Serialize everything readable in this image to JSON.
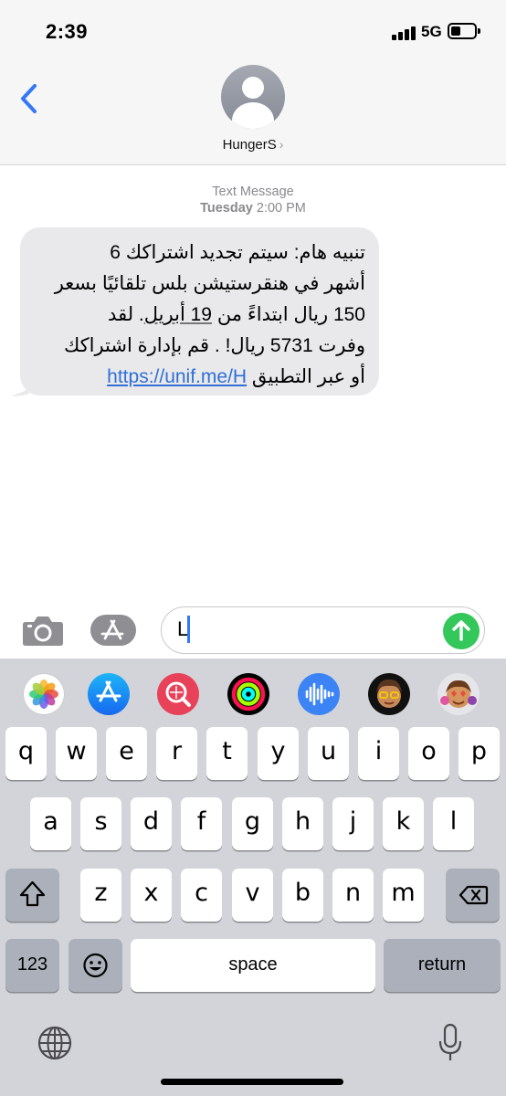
{
  "status_bar": {
    "time": "2:39",
    "network": "5G",
    "battery_icon": "battery-icon",
    "signal_icon": "cellular-signal-icon"
  },
  "header": {
    "back_icon": "chevron-left-icon",
    "avatar_icon": "person-avatar-icon",
    "contact_name": "HungerS",
    "name_chevron": "›"
  },
  "conversation": {
    "message_type": "Text Message",
    "timestamp_day": "Tuesday",
    "timestamp_time": "2:00 PM",
    "message": {
      "line1": "تنبيه هام: سيتم تجديد اشتراكك 6",
      "line2": "أشهر في هنقرستيشن بلس تلقائيًا بسعر",
      "line3_a": "150 ريال ابتداءً من ",
      "line3_date": "19 أبريل",
      "line3_b": ". لقد",
      "line4": "وفرت 5731 ريال! . قم بإدارة اشتراكك",
      "line5_a": "أو عبر التطبيق ",
      "line5_link": "https://unif.me/H"
    }
  },
  "input_bar": {
    "camera_icon": "camera-icon",
    "apps_icon": "app-store-icon",
    "text_value": "L",
    "send_icon": "arrow-up-icon"
  },
  "app_strip": [
    "photos-icon",
    "app-store-icon",
    "image-search-icon",
    "activity-rings-icon",
    "audio-message-icon",
    "memoji-icon",
    "memoji-stickers-icon"
  ],
  "keyboard": {
    "row1": [
      "q",
      "w",
      "e",
      "r",
      "t",
      "y",
      "u",
      "i",
      "o",
      "p"
    ],
    "row2": [
      "a",
      "s",
      "d",
      "f",
      "g",
      "h",
      "j",
      "k",
      "l"
    ],
    "row3": [
      "z",
      "x",
      "c",
      "v",
      "b",
      "n",
      "m"
    ],
    "numbers_label": "123",
    "space_label": "space",
    "return_label": "return",
    "shift_icon": "shift-icon",
    "delete_icon": "delete-backspace-icon",
    "emoji_icon": "emoji-icon",
    "globe_icon": "globe-icon",
    "mic_icon": "microphone-icon"
  },
  "colors": {
    "accent": "#3478f6",
    "send": "#34c759",
    "bubble": "#e9e9eb",
    "keyboard_bg": "#d2d4d9"
  }
}
